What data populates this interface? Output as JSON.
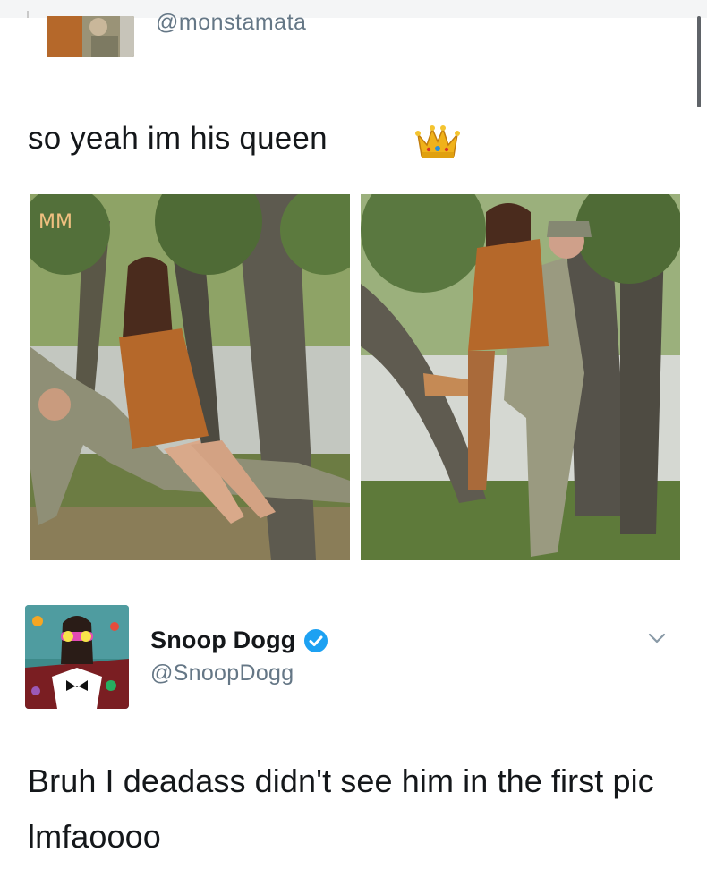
{
  "tweet_1": {
    "handle": "@monstamata",
    "text": "so yeah im his queen",
    "emoji": "crown-icon"
  },
  "photos": [
    {
      "name": "photo-couple-sitting",
      "overlay_mark": "MM"
    },
    {
      "name": "photo-couple-lift"
    }
  ],
  "tweet_2": {
    "display_name": "Snoop Dogg",
    "verified": true,
    "handle": "@SnoopDogg",
    "text": "Bruh I deadass didn't see him in the first pic lmfaoooo",
    "menu_icon": "chevron-down-icon"
  },
  "colors": {
    "text_primary": "#14171a",
    "text_secondary": "#657786",
    "verified_blue": "#1da1f2"
  }
}
